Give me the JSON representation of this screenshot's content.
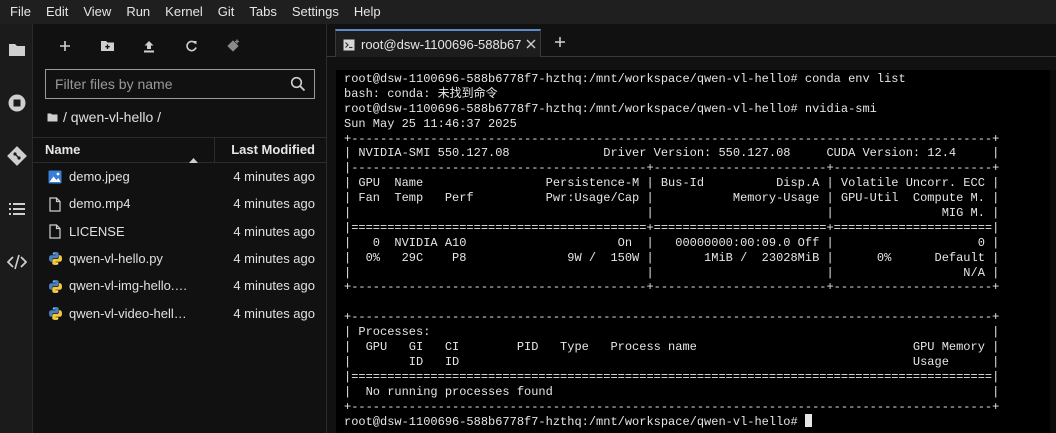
{
  "menubar": {
    "items": [
      "File",
      "Edit",
      "View",
      "Run",
      "Kernel",
      "Git",
      "Tabs",
      "Settings",
      "Help"
    ]
  },
  "activitybar": {
    "icons": [
      "folder-icon",
      "running-icon",
      "git-icon",
      "table-of-contents-icon",
      "extensions-icon"
    ]
  },
  "filebrowser": {
    "toolbar_icons": [
      "new-launcher-icon",
      "new-folder-icon",
      "upload-icon",
      "refresh-icon",
      "git-clone-icon"
    ],
    "search_placeholder": "Filter files by name",
    "breadcrumb": "/ qwen-vl-hello /",
    "columns": {
      "name": "Name",
      "modified": "Last Modified"
    },
    "files": [
      {
        "name": "demo.jpeg",
        "modified": "4 minutes ago",
        "icon": "image-file-icon"
      },
      {
        "name": "demo.mp4",
        "modified": "4 minutes ago",
        "icon": "file-icon"
      },
      {
        "name": "LICENSE",
        "modified": "4 minutes ago",
        "icon": "file-icon"
      },
      {
        "name": "qwen-vl-hello.py",
        "modified": "4 minutes ago",
        "icon": "python-file-icon"
      },
      {
        "name": "qwen-vl-img-hello.…",
        "modified": "4 minutes ago",
        "icon": "python-file-icon"
      },
      {
        "name": "qwen-vl-video-hell…",
        "modified": "4 minutes ago",
        "icon": "python-file-icon"
      }
    ]
  },
  "tabs": {
    "active_label": "root@dsw-1100696-588b677",
    "active_icon": "terminal-icon"
  },
  "terminal": {
    "lines": [
      "root@dsw-1100696-588b6778f7-hzthq:/mnt/workspace/qwen-vl-hello# conda env list",
      "bash: conda: 未找到命令",
      "root@dsw-1100696-588b6778f7-hzthq:/mnt/workspace/qwen-vl-hello# nvidia-smi",
      "Sun May 25 11:46:37 2025",
      "+-----------------------------------------------------------------------------------------+",
      "| NVIDIA-SMI 550.127.08             Driver Version: 550.127.08     CUDA Version: 12.4     |",
      "|-----------------------------------------+------------------------+----------------------+",
      "| GPU  Name                 Persistence-M | Bus-Id          Disp.A | Volatile Uncorr. ECC |",
      "| Fan  Temp   Perf          Pwr:Usage/Cap |           Memory-Usage | GPU-Util  Compute M. |",
      "|                                         |                        |               MIG M. |",
      "|=========================================+========================+======================|",
      "|   0  NVIDIA A10                     On  |   00000000:00:09.0 Off |                    0 |",
      "|  0%   29C    P8              9W /  150W |       1MiB /  23028MiB |      0%      Default |",
      "|                                         |                        |                  N/A |",
      "+-----------------------------------------+------------------------+----------------------+",
      "",
      "+-----------------------------------------------------------------------------------------+",
      "| Processes:                                                                              |",
      "|  GPU   GI   CI        PID   Type   Process name                              GPU Memory |",
      "|        ID   ID                                                               Usage      |",
      "|=========================================================================================|",
      "|  No running processes found                                                             |",
      "+-----------------------------------------------------------------------------------------+"
    ],
    "prompt": "root@dsw-1100696-588b6778f7-hzthq:/mnt/workspace/qwen-vl-hello# "
  }
}
